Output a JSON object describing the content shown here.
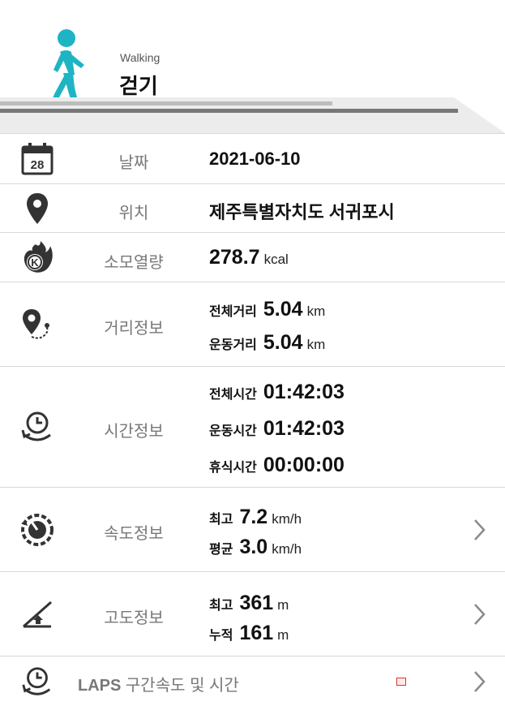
{
  "header": {
    "activity_en": "Walking",
    "activity_ko": "걷기",
    "accent_color": "#1fb4c4"
  },
  "date": {
    "label": "날짜",
    "value": "2021-06-10",
    "icon": "calendar-icon",
    "calendar_day": "28"
  },
  "location": {
    "label": "위치",
    "value": "제주특별자치도 서귀포시",
    "icon": "location-pin-icon"
  },
  "calories": {
    "label": "소모열량",
    "value": "278.7",
    "unit": "kcal",
    "icon": "calorie-flame-icon",
    "icon_letter": "K"
  },
  "distance": {
    "label": "거리정보",
    "icon": "route-pin-icon",
    "total_label": "전체거리",
    "total_value": "5.04",
    "total_unit": "km",
    "exercise_label": "운동거리",
    "exercise_value": "5.04",
    "exercise_unit": "km"
  },
  "time": {
    "label": "시간정보",
    "icon": "clock-cycle-icon",
    "total_label": "전체시간",
    "total_value": "01:42:03",
    "exercise_label": "운동시간",
    "exercise_value": "01:42:03",
    "rest_label": "휴식시간",
    "rest_value": "00:00:00"
  },
  "speed": {
    "label": "속도정보",
    "icon": "speedometer-icon",
    "max_label": "최고",
    "max_value": "7.2",
    "max_unit": "km/h",
    "avg_label": "평균",
    "avg_value": "3.0",
    "avg_unit": "km/h"
  },
  "altitude": {
    "label": "고도정보",
    "icon": "altitude-slope-icon",
    "max_label": "최고",
    "max_value": "361",
    "max_unit": "m",
    "cum_label": "누적",
    "cum_value": "161",
    "cum_unit": "m"
  },
  "laps": {
    "label_prefix": "LAPS",
    "label_rest": "구간속도 및 시간",
    "icon": "clock-cycle-icon"
  }
}
